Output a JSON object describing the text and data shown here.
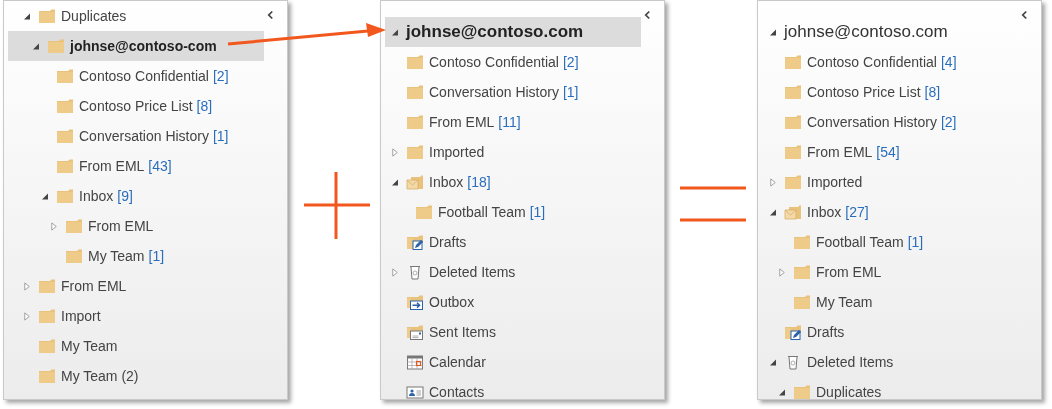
{
  "panels": [
    {
      "tree": [
        {
          "label": "Duplicates",
          "kind": "folder",
          "expanded": true,
          "selected": false,
          "children": [
            {
              "label": "johnse@contoso-com",
              "kind": "folder",
              "expanded": true,
              "selected": true,
              "children": [
                {
                  "label": "Contoso Confidential",
                  "count": "[2]",
                  "kind": "folder",
                  "selected": false
                },
                {
                  "label": "Contoso Price List",
                  "count": "[8]",
                  "kind": "folder",
                  "selected": false
                },
                {
                  "label": "Conversation History",
                  "count": "[1]",
                  "kind": "folder",
                  "selected": false
                },
                {
                  "label": "From EML",
                  "count": "[43]",
                  "kind": "folder",
                  "selected": false
                },
                {
                  "label": "Inbox",
                  "count": "[9]",
                  "kind": "folder",
                  "expanded": true,
                  "selected": false,
                  "children": [
                    {
                      "label": "From EML",
                      "kind": "folder",
                      "expanded": false,
                      "selected": false
                    },
                    {
                      "label": "My Team",
                      "count": "[1]",
                      "kind": "folder",
                      "selected": false
                    }
                  ]
                }
              ]
            }
          ]
        },
        {
          "label": "From EML",
          "kind": "folder",
          "expanded": false,
          "selected": false
        },
        {
          "label": "Import",
          "kind": "folder",
          "expanded": false,
          "selected": false
        },
        {
          "label": "My Team",
          "kind": "folder",
          "selected": false
        },
        {
          "label": "My Team (2)",
          "kind": "folder",
          "selected": false
        }
      ]
    },
    {
      "tree": [
        {
          "label": "johnse@contoso.com",
          "kind": "account",
          "expanded": true,
          "selected": true,
          "children": [
            {
              "label": "Contoso Confidential",
              "count": "[2]",
              "kind": "folder",
              "selected": false
            },
            {
              "label": "Conversation History",
              "count": "[1]",
              "kind": "folder",
              "selected": false
            },
            {
              "label": "From EML",
              "count": "[11]",
              "kind": "folder",
              "selected": false
            },
            {
              "label": "Imported",
              "kind": "folder",
              "expanded": false,
              "selected": false
            },
            {
              "label": "Inbox",
              "count": "[18]",
              "kind": "inbox",
              "expanded": true,
              "selected": false,
              "children": [
                {
                  "label": "Football Team",
                  "count": "[1]",
                  "kind": "folder",
                  "selected": false
                }
              ]
            },
            {
              "label": "Drafts",
              "kind": "drafts",
              "selected": false
            },
            {
              "label": "Deleted Items",
              "kind": "deleted",
              "expanded": false,
              "selected": false
            },
            {
              "label": "Outbox",
              "kind": "outbox",
              "selected": false
            },
            {
              "label": "Sent Items",
              "kind": "sent",
              "selected": false
            },
            {
              "label": "Calendar",
              "kind": "calendar",
              "selected": false
            },
            {
              "label": "Contacts",
              "kind": "contacts",
              "selected": false
            }
          ]
        }
      ]
    },
    {
      "tree": [
        {
          "label": "johnse@contoso.com",
          "kind": "account",
          "expanded": true,
          "selected": false,
          "children": [
            {
              "label": "Contoso Confidential",
              "count": "[4]",
              "kind": "folder",
              "selected": false
            },
            {
              "label": "Contoso Price List",
              "count": "[8]",
              "kind": "folder",
              "selected": false
            },
            {
              "label": "Conversation History",
              "count": "[2]",
              "kind": "folder",
              "selected": false
            },
            {
              "label": "From EML",
              "count": "[54]",
              "kind": "folder",
              "selected": false
            },
            {
              "label": "Imported",
              "kind": "folder",
              "expanded": false,
              "selected": false
            },
            {
              "label": "Inbox",
              "count": "[27]",
              "kind": "inbox",
              "expanded": true,
              "selected": false,
              "children": [
                {
                  "label": "Football Team",
                  "count": "[1]",
                  "kind": "folder",
                  "selected": false
                },
                {
                  "label": "From EML",
                  "kind": "folder",
                  "expanded": false,
                  "selected": false
                },
                {
                  "label": "My Team",
                  "kind": "folder",
                  "selected": false
                }
              ]
            },
            {
              "label": "Drafts",
              "kind": "drafts",
              "selected": false
            },
            {
              "label": "Deleted Items",
              "kind": "deleted",
              "expanded": true,
              "selected": false,
              "children": [
                {
                  "label": "Duplicates",
                  "kind": "folder",
                  "expanded": true,
                  "selected": false
                }
              ]
            }
          ]
        }
      ]
    }
  ]
}
